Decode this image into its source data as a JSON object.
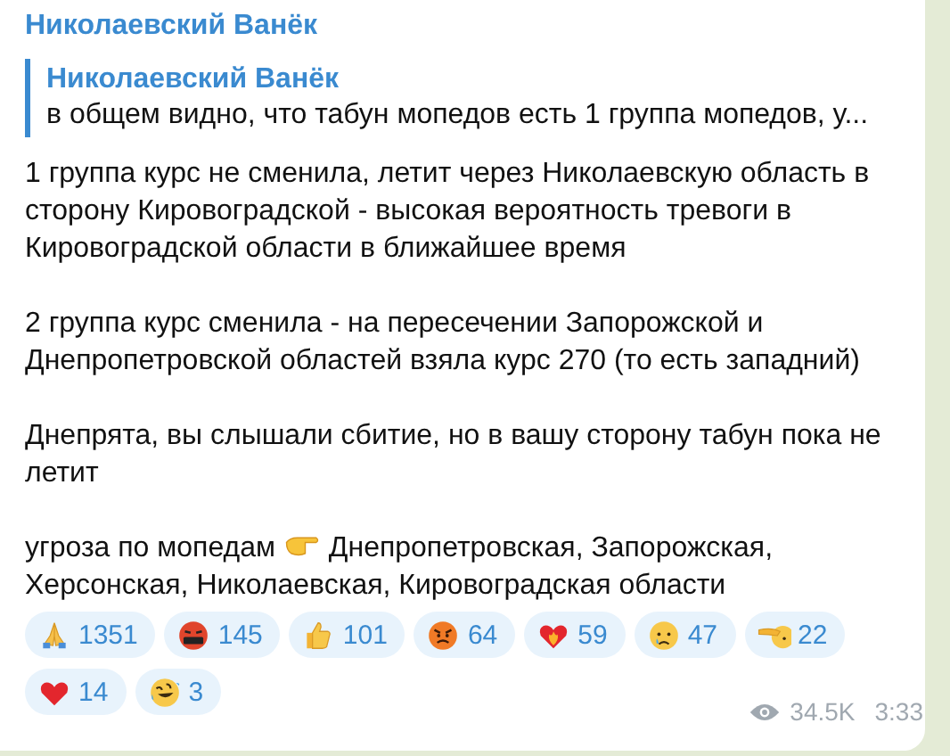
{
  "message": {
    "author": "Николаевский Ванёк",
    "reply": {
      "author": "Николаевский Ванёк",
      "text": "в общем видно, что табун мопедов есть  1 группа мопедов, у..."
    },
    "paragraphs": [
      "1 группа курс не сменила, летит через Николаевскую область в сторону Кировоградской - высокая вероятность тревоги в Кировоградской области в ближайшее время",
      "2 группа курс сменила - на пересечении Запорожской и Днепропетровской областей взяла курс 270 (то есть западний)",
      "Днепрята, вы слышали сбитие, но в вашу сторону табун пока не летит"
    ],
    "threat": {
      "before": "угроза по мопедам",
      "after": "Днепропетровская, Запорожская, Херсонская, Николаевская, Кировоградская области"
    },
    "reactions": [
      {
        "kind": "pray",
        "count": "1351"
      },
      {
        "kind": "cursing",
        "count": "145"
      },
      {
        "kind": "thumbsup",
        "count": "101"
      },
      {
        "kind": "angry",
        "count": "64"
      },
      {
        "kind": "fireheart",
        "count": "59"
      },
      {
        "kind": "crying",
        "count": "47"
      },
      {
        "kind": "salute",
        "count": "22"
      },
      {
        "kind": "heart",
        "count": "14"
      },
      {
        "kind": "rofl",
        "count": "3"
      }
    ],
    "views": "34.5K",
    "time": "3:33"
  }
}
